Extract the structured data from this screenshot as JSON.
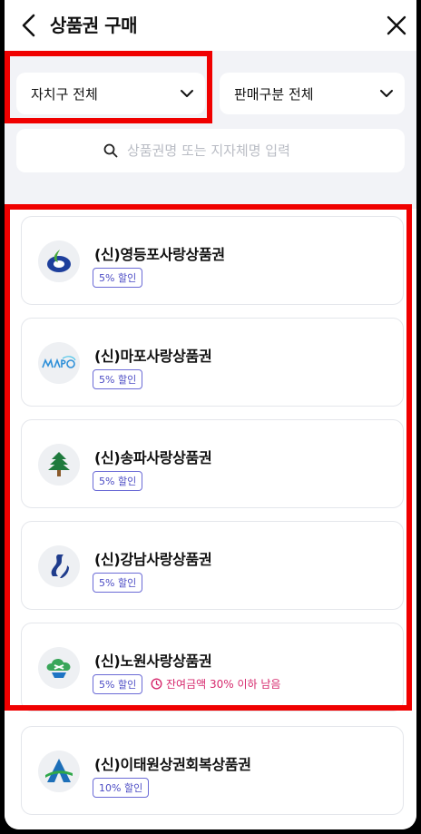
{
  "header": {
    "title": "상품권 구매",
    "back_icon": "chevron-left-icon",
    "close_icon": "close-icon"
  },
  "filters": {
    "district_select": "자치구 전체",
    "sale_type_select": "판매구분 전체",
    "search_placeholder": "상품권명 또는 지자체명 입력"
  },
  "vouchers": [
    {
      "name": "(신)영등포사랑상품권",
      "discount": "5% 할인",
      "logo": "yeongdeungpo-logo"
    },
    {
      "name": "(신)마포사랑상품권",
      "discount": "5% 할인",
      "logo": "mapo-logo"
    },
    {
      "name": "(신)송파사랑상품권",
      "discount": "5% 할인",
      "logo": "songpa-logo"
    },
    {
      "name": "(신)강남사랑상품권",
      "discount": "5% 할인",
      "logo": "gangnam-logo"
    },
    {
      "name": "(신)노원사랑상품권",
      "discount": "5% 할인",
      "logo": "nowon-logo",
      "warning": "잔여금액 30% 이하 남음"
    },
    {
      "name": "(신)이태원상권회복상품권",
      "discount": "10% 할인",
      "logo": "itaewon-logo"
    }
  ],
  "colors": {
    "highlight": "#f00000",
    "badge": "#4b4bc4",
    "warning": "#d6296d",
    "background": "#f2f3f7"
  }
}
